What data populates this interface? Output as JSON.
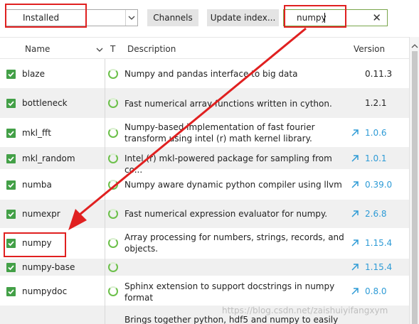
{
  "toolbar": {
    "filter_select": {
      "selected": "Installed"
    },
    "channels_label": "Channels",
    "update_index_label": "Update index...",
    "search": {
      "value": "numpy",
      "clear_glyph": "✕"
    }
  },
  "table": {
    "headers": {
      "name": "Name",
      "type": "T",
      "description": "Description",
      "version": "Version"
    },
    "rows": [
      {
        "name": "blaze",
        "description": "Numpy and pandas interface to big data",
        "version": "0.11.3",
        "upgradable": false
      },
      {
        "name": "bottleneck",
        "description": "Fast numerical array functions written in cython.",
        "version": "1.2.1",
        "upgradable": false
      },
      {
        "name": "mkl_fft",
        "description": "Numpy-based implementation of fast fourier transform using intel (r) math kernel library.",
        "version": "1.0.6",
        "upgradable": true
      },
      {
        "name": "mkl_random",
        "description": "Intel (r) mkl-powered package for sampling from co...",
        "version": "1.0.1",
        "upgradable": true
      },
      {
        "name": "numba",
        "description": "Numpy aware dynamic python compiler using llvm",
        "version": "0.39.0",
        "upgradable": true
      },
      {
        "name": "numexpr",
        "description": "Fast numerical expression evaluator for numpy.",
        "version": "2.6.8",
        "upgradable": true
      },
      {
        "name": "numpy",
        "description": "Array processing for numbers, strings, records, and objects.",
        "version": "1.15.4",
        "upgradable": true
      },
      {
        "name": "numpy-base",
        "description": "",
        "version": "1.15.4",
        "upgradable": true
      },
      {
        "name": "numpydoc",
        "description": "Sphinx extension to support docstrings in numpy format",
        "version": "0.8.0",
        "upgradable": true
      },
      {
        "name": "",
        "description": "Brings together python, hdf5 and numpy to easily",
        "version": "",
        "upgradable": false
      }
    ]
  },
  "watermark": "https://blog.csdn.net/zaishuiyifangxym",
  "colors": {
    "check": "#43a047",
    "upgrade": "#2e9bd6",
    "annotation": "#e02020"
  }
}
